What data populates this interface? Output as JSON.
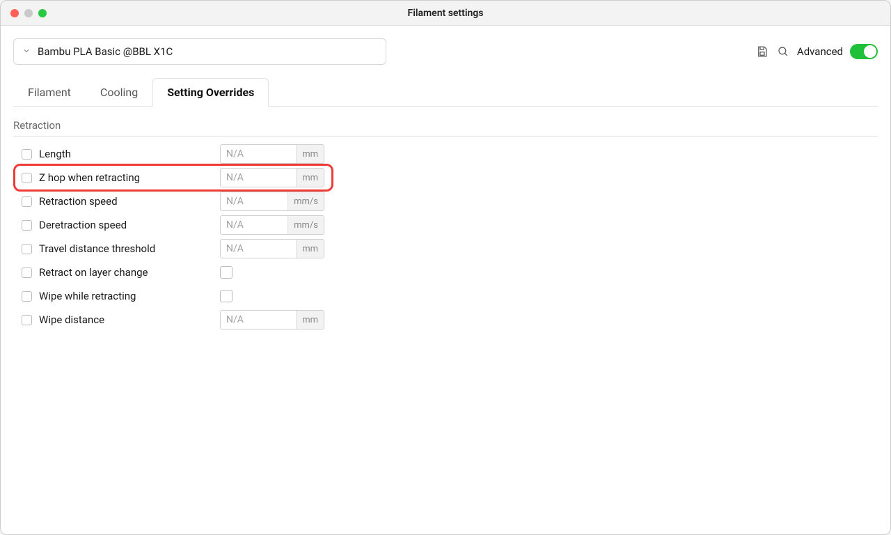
{
  "window": {
    "title": "Filament settings"
  },
  "preset": {
    "name": "Bambu PLA Basic @BBL X1C"
  },
  "toolbar": {
    "save_icon": "save-icon",
    "search_icon": "search-icon",
    "advanced_label": "Advanced",
    "advanced_on": true
  },
  "tabs": [
    {
      "id": "filament",
      "label": "Filament",
      "active": false
    },
    {
      "id": "cooling",
      "label": "Cooling",
      "active": false
    },
    {
      "id": "overrides",
      "label": "Setting Overrides",
      "active": true
    }
  ],
  "section": {
    "title": "Retraction"
  },
  "rows": [
    {
      "id": "length",
      "label": "Length",
      "type": "number",
      "placeholder": "N/A",
      "unit": "mm"
    },
    {
      "id": "zhop",
      "label": "Z hop when retracting",
      "type": "number",
      "placeholder": "N/A",
      "unit": "mm",
      "highlighted": true
    },
    {
      "id": "retr_speed",
      "label": "Retraction speed",
      "type": "number",
      "placeholder": "N/A",
      "unit": "mm/s"
    },
    {
      "id": "deretr_speed",
      "label": "Deretraction speed",
      "type": "number",
      "placeholder": "N/A",
      "unit": "mm/s"
    },
    {
      "id": "travel_thresh",
      "label": "Travel distance threshold",
      "type": "number",
      "placeholder": "N/A",
      "unit": "mm"
    },
    {
      "id": "retr_layer_change",
      "label": "Retract on layer change",
      "type": "check"
    },
    {
      "id": "wipe_retracting",
      "label": "Wipe while retracting",
      "type": "check"
    },
    {
      "id": "wipe_distance",
      "label": "Wipe distance",
      "type": "number",
      "placeholder": "N/A",
      "unit": "mm"
    }
  ]
}
